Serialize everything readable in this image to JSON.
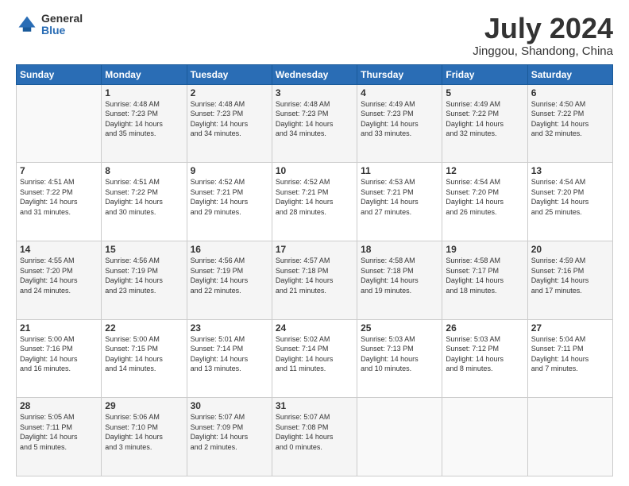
{
  "logo": {
    "general": "General",
    "blue": "Blue"
  },
  "header": {
    "month": "July 2024",
    "location": "Jinggou, Shandong, China"
  },
  "days_of_week": [
    "Sunday",
    "Monday",
    "Tuesday",
    "Wednesday",
    "Thursday",
    "Friday",
    "Saturday"
  ],
  "weeks": [
    [
      {
        "day": "",
        "info": ""
      },
      {
        "day": "1",
        "info": "Sunrise: 4:48 AM\nSunset: 7:23 PM\nDaylight: 14 hours\nand 35 minutes."
      },
      {
        "day": "2",
        "info": "Sunrise: 4:48 AM\nSunset: 7:23 PM\nDaylight: 14 hours\nand 34 minutes."
      },
      {
        "day": "3",
        "info": "Sunrise: 4:48 AM\nSunset: 7:23 PM\nDaylight: 14 hours\nand 34 minutes."
      },
      {
        "day": "4",
        "info": "Sunrise: 4:49 AM\nSunset: 7:23 PM\nDaylight: 14 hours\nand 33 minutes."
      },
      {
        "day": "5",
        "info": "Sunrise: 4:49 AM\nSunset: 7:22 PM\nDaylight: 14 hours\nand 32 minutes."
      },
      {
        "day": "6",
        "info": "Sunrise: 4:50 AM\nSunset: 7:22 PM\nDaylight: 14 hours\nand 32 minutes."
      }
    ],
    [
      {
        "day": "7",
        "info": "Sunrise: 4:51 AM\nSunset: 7:22 PM\nDaylight: 14 hours\nand 31 minutes."
      },
      {
        "day": "8",
        "info": "Sunrise: 4:51 AM\nSunset: 7:22 PM\nDaylight: 14 hours\nand 30 minutes."
      },
      {
        "day": "9",
        "info": "Sunrise: 4:52 AM\nSunset: 7:21 PM\nDaylight: 14 hours\nand 29 minutes."
      },
      {
        "day": "10",
        "info": "Sunrise: 4:52 AM\nSunset: 7:21 PM\nDaylight: 14 hours\nand 28 minutes."
      },
      {
        "day": "11",
        "info": "Sunrise: 4:53 AM\nSunset: 7:21 PM\nDaylight: 14 hours\nand 27 minutes."
      },
      {
        "day": "12",
        "info": "Sunrise: 4:54 AM\nSunset: 7:20 PM\nDaylight: 14 hours\nand 26 minutes."
      },
      {
        "day": "13",
        "info": "Sunrise: 4:54 AM\nSunset: 7:20 PM\nDaylight: 14 hours\nand 25 minutes."
      }
    ],
    [
      {
        "day": "14",
        "info": "Sunrise: 4:55 AM\nSunset: 7:20 PM\nDaylight: 14 hours\nand 24 minutes."
      },
      {
        "day": "15",
        "info": "Sunrise: 4:56 AM\nSunset: 7:19 PM\nDaylight: 14 hours\nand 23 minutes."
      },
      {
        "day": "16",
        "info": "Sunrise: 4:56 AM\nSunset: 7:19 PM\nDaylight: 14 hours\nand 22 minutes."
      },
      {
        "day": "17",
        "info": "Sunrise: 4:57 AM\nSunset: 7:18 PM\nDaylight: 14 hours\nand 21 minutes."
      },
      {
        "day": "18",
        "info": "Sunrise: 4:58 AM\nSunset: 7:18 PM\nDaylight: 14 hours\nand 19 minutes."
      },
      {
        "day": "19",
        "info": "Sunrise: 4:58 AM\nSunset: 7:17 PM\nDaylight: 14 hours\nand 18 minutes."
      },
      {
        "day": "20",
        "info": "Sunrise: 4:59 AM\nSunset: 7:16 PM\nDaylight: 14 hours\nand 17 minutes."
      }
    ],
    [
      {
        "day": "21",
        "info": "Sunrise: 5:00 AM\nSunset: 7:16 PM\nDaylight: 14 hours\nand 16 minutes."
      },
      {
        "day": "22",
        "info": "Sunrise: 5:00 AM\nSunset: 7:15 PM\nDaylight: 14 hours\nand 14 minutes."
      },
      {
        "day": "23",
        "info": "Sunrise: 5:01 AM\nSunset: 7:14 PM\nDaylight: 14 hours\nand 13 minutes."
      },
      {
        "day": "24",
        "info": "Sunrise: 5:02 AM\nSunset: 7:14 PM\nDaylight: 14 hours\nand 11 minutes."
      },
      {
        "day": "25",
        "info": "Sunrise: 5:03 AM\nSunset: 7:13 PM\nDaylight: 14 hours\nand 10 minutes."
      },
      {
        "day": "26",
        "info": "Sunrise: 5:03 AM\nSunset: 7:12 PM\nDaylight: 14 hours\nand 8 minutes."
      },
      {
        "day": "27",
        "info": "Sunrise: 5:04 AM\nSunset: 7:11 PM\nDaylight: 14 hours\nand 7 minutes."
      }
    ],
    [
      {
        "day": "28",
        "info": "Sunrise: 5:05 AM\nSunset: 7:11 PM\nDaylight: 14 hours\nand 5 minutes."
      },
      {
        "day": "29",
        "info": "Sunrise: 5:06 AM\nSunset: 7:10 PM\nDaylight: 14 hours\nand 3 minutes."
      },
      {
        "day": "30",
        "info": "Sunrise: 5:07 AM\nSunset: 7:09 PM\nDaylight: 14 hours\nand 2 minutes."
      },
      {
        "day": "31",
        "info": "Sunrise: 5:07 AM\nSunset: 7:08 PM\nDaylight: 14 hours\nand 0 minutes."
      },
      {
        "day": "",
        "info": ""
      },
      {
        "day": "",
        "info": ""
      },
      {
        "day": "",
        "info": ""
      }
    ]
  ]
}
